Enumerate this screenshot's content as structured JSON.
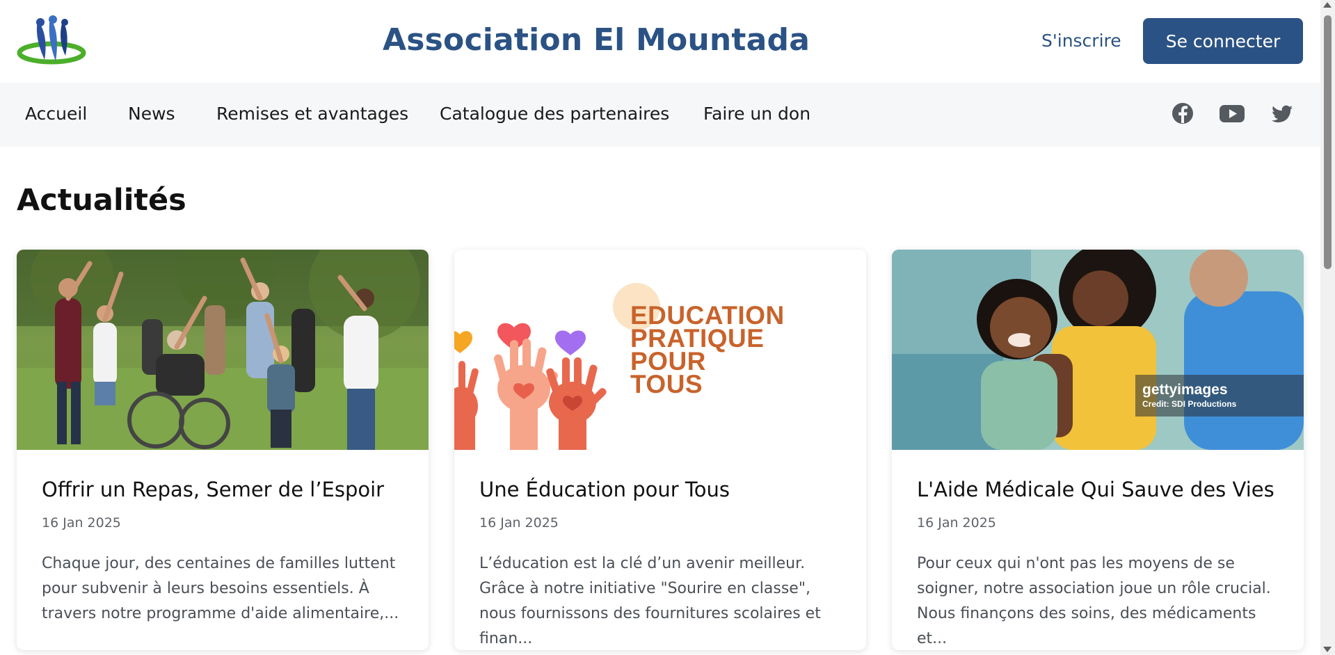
{
  "header": {
    "title": "Association El Mountada",
    "signup_label": "S'inscrire",
    "login_label": "Se connecter",
    "logo_icon": "people-logo-icon"
  },
  "nav": {
    "items": [
      {
        "label": "Accueil"
      },
      {
        "label": "News"
      },
      {
        "label": "Remises et avantages"
      },
      {
        "label": "Catalogue des partenaires"
      },
      {
        "label": "Faire un don"
      }
    ],
    "social": [
      "facebook-icon",
      "youtube-icon",
      "twitter-icon"
    ]
  },
  "main": {
    "section_title": "Actualités",
    "cards": [
      {
        "title": "Offrir un Repas, Semer de l’Espoir",
        "date": "16 Jan 2025",
        "text": "Chaque jour, des centaines de familles luttent pour subvenir à leurs besoins essentiels. À travers notre programme d'aide alimentaire,..."
      },
      {
        "title": "Une Éducation pour Tous",
        "date": "16 Jan 2025",
        "text": "L’éducation est la clé d’un avenir meilleur. Grâce à notre initiative \"Sourire en classe\", nous fournissons des fournitures scolaires et finan...",
        "image_text": [
          "EDUCATION",
          "PRATIQUE",
          "POUR",
          "TOUS"
        ]
      },
      {
        "title": "L'Aide Médicale Qui Sauve des Vies",
        "date": "16 Jan 2025",
        "text": "Pour ceux qui n'ont pas les moyens de se soigner, notre association joue un rôle crucial. Nous finançons des soins, des médicaments et...",
        "watermark": "gettyimages",
        "credit": "Credit: SDI Productions"
      }
    ]
  },
  "colors": {
    "brand": "#2b5284",
    "nav_bg": "#f6f7f9",
    "edu_orange": "#c8632b"
  }
}
